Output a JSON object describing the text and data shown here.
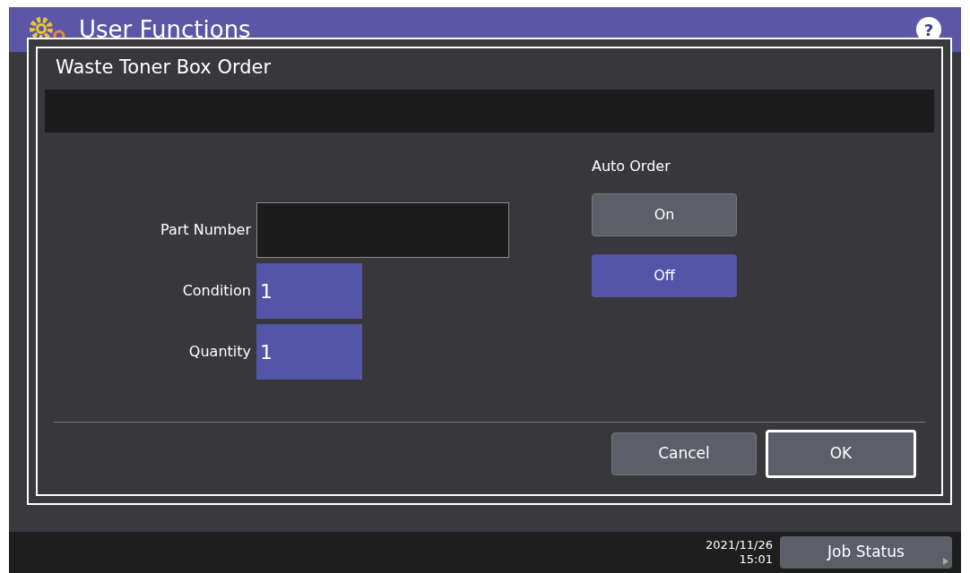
{
  "header": {
    "title": "User Functions",
    "help": "?"
  },
  "dialog": {
    "title": "Waste Toner Box Order",
    "fields": [
      {
        "label": "Part Number",
        "kind": "text"
      },
      {
        "label": "Condition",
        "value": "1",
        "kind": "number"
      },
      {
        "label": "Quantity",
        "value": "1",
        "kind": "number"
      }
    ],
    "auto_order": {
      "label": "Auto Order",
      "options": [
        {
          "label": "On",
          "selected": false
        },
        {
          "label": "Off",
          "selected": true
        }
      ]
    },
    "buttons": [
      {
        "label": "Cancel",
        "default": false
      },
      {
        "label": "OK",
        "default": true
      }
    ]
  },
  "status_bar": {
    "date": "2021/11/26",
    "time": "15:01",
    "job_status": "Job Status"
  }
}
